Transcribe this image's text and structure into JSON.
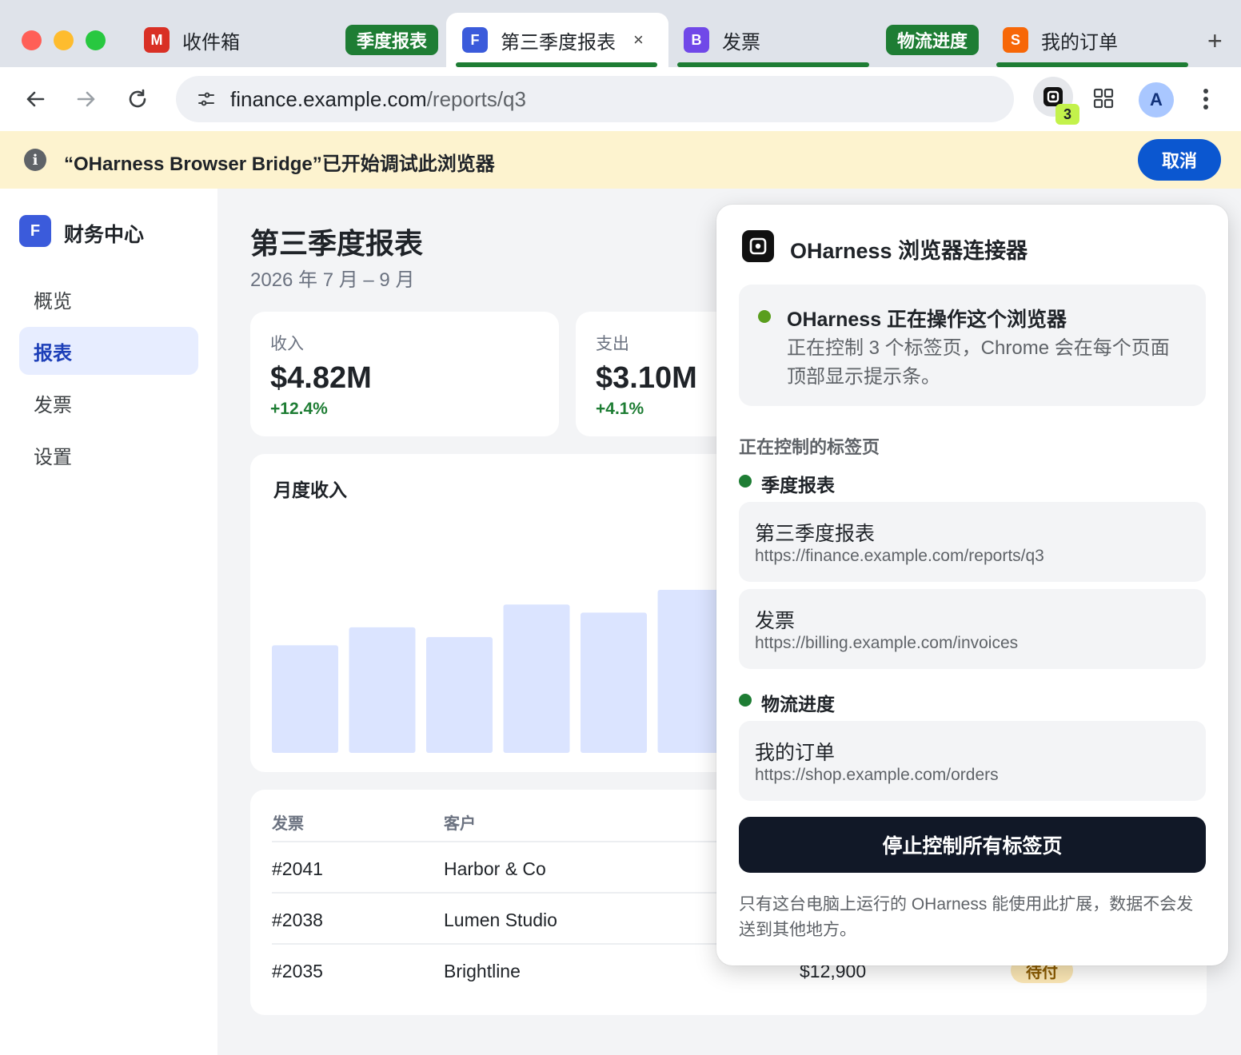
{
  "browser": {
    "tabs": [
      {
        "label": "收件箱",
        "favicon": "M",
        "favicon_color": "#d93025"
      },
      {
        "label": "第三季度报表",
        "favicon": "F",
        "favicon_color": "#3b5bdb",
        "active": true
      },
      {
        "label": "发票",
        "favicon": "B",
        "favicon_color": "#7048e8"
      },
      {
        "label": "我的订单",
        "favicon": "S",
        "favicon_color": "#f76707"
      }
    ],
    "tab_groups": [
      {
        "label": "季度报表",
        "color": "#1e7d34"
      },
      {
        "label": "物流进度",
        "color": "#1e7d34"
      }
    ],
    "close_glyph": "×",
    "new_tab_glyph": "+",
    "url_host": "finance.example.com",
    "url_path": "/reports/q3",
    "extension_badge": "3",
    "avatar_letter": "A"
  },
  "infobar": {
    "message": "“OHarness Browser Bridge”已开始调试此浏览器",
    "cancel_label": "取消",
    "info_glyph": "i"
  },
  "sidebar": {
    "brand_logo": "F",
    "brand_name": "财务中心",
    "items": [
      {
        "label": "概览"
      },
      {
        "label": "报表",
        "active": true
      },
      {
        "label": "发票"
      },
      {
        "label": "设置"
      }
    ]
  },
  "main": {
    "title": "第三季度报表",
    "subtitle": "2026 年 7 月 – 9 月",
    "kpis": [
      {
        "label": "收入",
        "value": "$4.82M",
        "delta": "+12.4%"
      },
      {
        "label": "支出",
        "value": "$3.10M",
        "delta": "+4.1%"
      }
    ],
    "chart_title": "月度收入",
    "table": {
      "headers": [
        "发票",
        "客户"
      ],
      "rows": [
        {
          "id": "#2041",
          "client": "Harbor & Co"
        },
        {
          "id": "#2038",
          "client": "Lumen Studio"
        },
        {
          "id": "#2035",
          "client": "Brightline",
          "amount": "$12,900",
          "status": "待付"
        }
      ]
    }
  },
  "chart_data": {
    "type": "bar",
    "title": "月度收入",
    "values": [
      0.66,
      0.77,
      0.71,
      0.91,
      0.86,
      1.0
    ],
    "bar_color": "#dbe4ff"
  },
  "popup": {
    "title": "OHarness 浏览器连接器",
    "status_title": "OHarness 正在操作这个浏览器",
    "status_desc": "正在控制 3 个标签页，Chrome 会在每个页面顶部显示提示条。",
    "section_label": "正在控制的标签页",
    "groups": [
      {
        "label": "季度报表",
        "tabs": [
          {
            "title": "第三季度报表",
            "url": "https://finance.example.com/reports/q3"
          },
          {
            "title": "发票",
            "url": "https://billing.example.com/invoices"
          }
        ]
      },
      {
        "label": "物流进度",
        "tabs": [
          {
            "title": "我的订单",
            "url": "https://shop.example.com/orders"
          }
        ]
      }
    ],
    "stop_label": "停止控制所有标签页",
    "footnote": "只有这台电脑上运行的 OHarness 能使用此扩展，数据不会发送到其他地方。"
  },
  "colors": {
    "accent": "#0b57d0",
    "group_green": "#1e7d34",
    "infobar_bg": "#fdf3cf",
    "badge": "#c3f24b"
  }
}
